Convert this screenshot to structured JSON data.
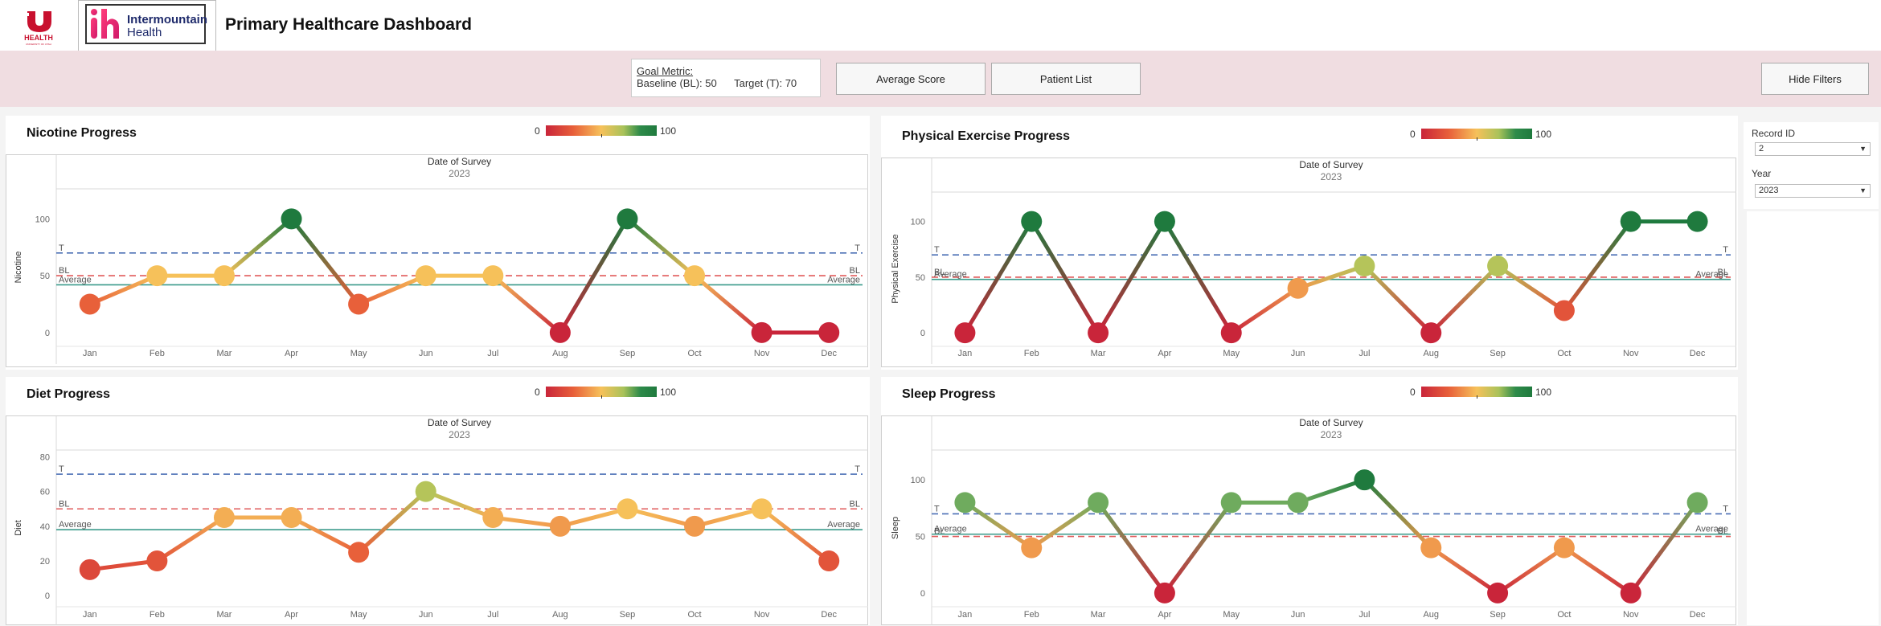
{
  "header": {
    "uh_logo_text": "HEALTH",
    "uh_logo_sub": "UNIVERSITY OF UTAH",
    "ih_logo_text_line1": "Intermountain",
    "ih_logo_text_line2": "Health",
    "title": "Primary Healthcare Dashboard"
  },
  "toolbar": {
    "goal_title": "Goal Metric:",
    "baseline_text": "Baseline (BL): 50",
    "target_text": "Target (T): 70",
    "average_score_label": "Average Score",
    "patient_list_label": "Patient List",
    "hide_filters_label": "Hide Filters"
  },
  "filters": {
    "record_id_label": "Record ID",
    "record_id_value": "2",
    "year_label": "Year",
    "year_value": "2023"
  },
  "legend": {
    "min": "0",
    "max": "100"
  },
  "colors": {
    "target_line": "#4a6fb5",
    "baseline_line": "#e05a5a",
    "average_line": "#3a9a8a",
    "low": "#c9253a",
    "high": "#1f7a3e"
  },
  "chart_data": [
    {
      "type": "line",
      "title": "Nicotine Progress",
      "header": "Date of Survey",
      "year": "2023",
      "ylabel": "Nicotine",
      "categories": [
        "Jan",
        "Feb",
        "Mar",
        "Apr",
        "May",
        "Jun",
        "Jul",
        "Aug",
        "Sep",
        "Oct",
        "Nov",
        "Dec"
      ],
      "values": [
        25,
        50,
        50,
        100,
        25,
        50,
        50,
        0,
        100,
        50,
        0,
        0
      ],
      "yticks": [
        0,
        50,
        100
      ],
      "ylim": [
        -10,
        125
      ],
      "target": 70,
      "baseline": 50,
      "average": 42,
      "target_label": "T",
      "baseline_label": "BL",
      "average_label": "Average"
    },
    {
      "type": "line",
      "title": "Physical Exercise Progress",
      "header": "Date of Survey",
      "year": "2023",
      "ylabel": "Physical Exercise",
      "categories": [
        "Jan",
        "Feb",
        "Mar",
        "Apr",
        "May",
        "Jun",
        "Jul",
        "Aug",
        "Sep",
        "Oct",
        "Nov",
        "Dec"
      ],
      "values": [
        0,
        100,
        0,
        100,
        0,
        40,
        60,
        0,
        60,
        20,
        100,
        100
      ],
      "yticks": [
        0,
        50,
        100
      ],
      "ylim": [
        -10,
        125
      ],
      "target": 70,
      "baseline": 50,
      "average": 48,
      "target_label": "T",
      "baseline_label": "BL",
      "average_label": "Average"
    },
    {
      "type": "line",
      "title": "Diet Progress",
      "header": "Date of Survey",
      "year": "2023",
      "ylabel": "Diet",
      "categories": [
        "Jan",
        "Feb",
        "Mar",
        "Apr",
        "May",
        "Jun",
        "Jul",
        "Aug",
        "Sep",
        "Oct",
        "Nov",
        "Dec"
      ],
      "values": [
        15,
        20,
        45,
        45,
        25,
        60,
        45,
        40,
        50,
        40,
        50,
        20
      ],
      "yticks": [
        0,
        20,
        40,
        60,
        80
      ],
      "ylim": [
        -5,
        83
      ],
      "target": 70,
      "baseline": 50,
      "average": 38,
      "target_label": "T",
      "baseline_label": "BL",
      "average_label": "Average"
    },
    {
      "type": "line",
      "title": "Sleep Progress",
      "header": "Date of Survey",
      "year": "2023",
      "ylabel": "Sleep",
      "categories": [
        "Jan",
        "Feb",
        "Mar",
        "Apr",
        "May",
        "Jun",
        "Jul",
        "Aug",
        "Sep",
        "Oct",
        "Nov",
        "Dec"
      ],
      "values": [
        80,
        40,
        80,
        0,
        80,
        80,
        100,
        40,
        0,
        40,
        0,
        80
      ],
      "yticks": [
        0,
        50,
        100
      ],
      "ylim": [
        -10,
        125
      ],
      "target": 70,
      "baseline": 50,
      "average": 52,
      "target_label": "T",
      "baseline_label": "BL",
      "average_label": "Average"
    }
  ]
}
